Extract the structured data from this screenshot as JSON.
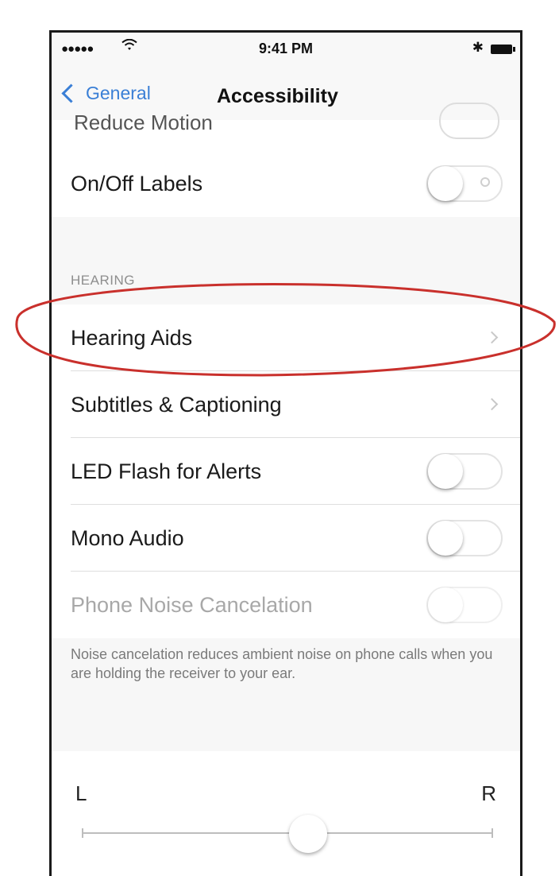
{
  "status_bar": {
    "signal": "●●●●● ",
    "time": "9:41 PM",
    "bluetooth": "✱"
  },
  "nav": {
    "back_label": "General",
    "title": "Accessibility"
  },
  "partial_row": {
    "label": "Reduce Motion"
  },
  "rows": {
    "onoff_labels": {
      "label": "On/Off Labels",
      "toggle_on": false
    },
    "hearing_aids": {
      "label": "Hearing Aids"
    },
    "subtitles": {
      "label": "Subtitles & Captioning"
    },
    "led_flash": {
      "label": "LED Flash for Alerts",
      "toggle_on": false
    },
    "mono_audio": {
      "label": "Mono Audio",
      "toggle_on": false
    },
    "noise_cancel": {
      "label": "Phone Noise Cancelation",
      "toggle_on": false,
      "disabled": true
    }
  },
  "section_hearing": {
    "header": "HEARING"
  },
  "footer_note": "Noise cancelation reduces ambient noise on phone calls when you are holding the receiver to your ear.",
  "balance": {
    "left_label": "L",
    "right_label": "R",
    "value": 0.55
  },
  "colors": {
    "accent": "#3a7fd6",
    "highlight": "#c9302c"
  },
  "icons": {
    "back": "chevron-left-icon",
    "disclosure": "chevron-right-icon",
    "wifi": "wifi-icon",
    "bluetooth": "bluetooth-icon",
    "battery": "battery-icon"
  }
}
